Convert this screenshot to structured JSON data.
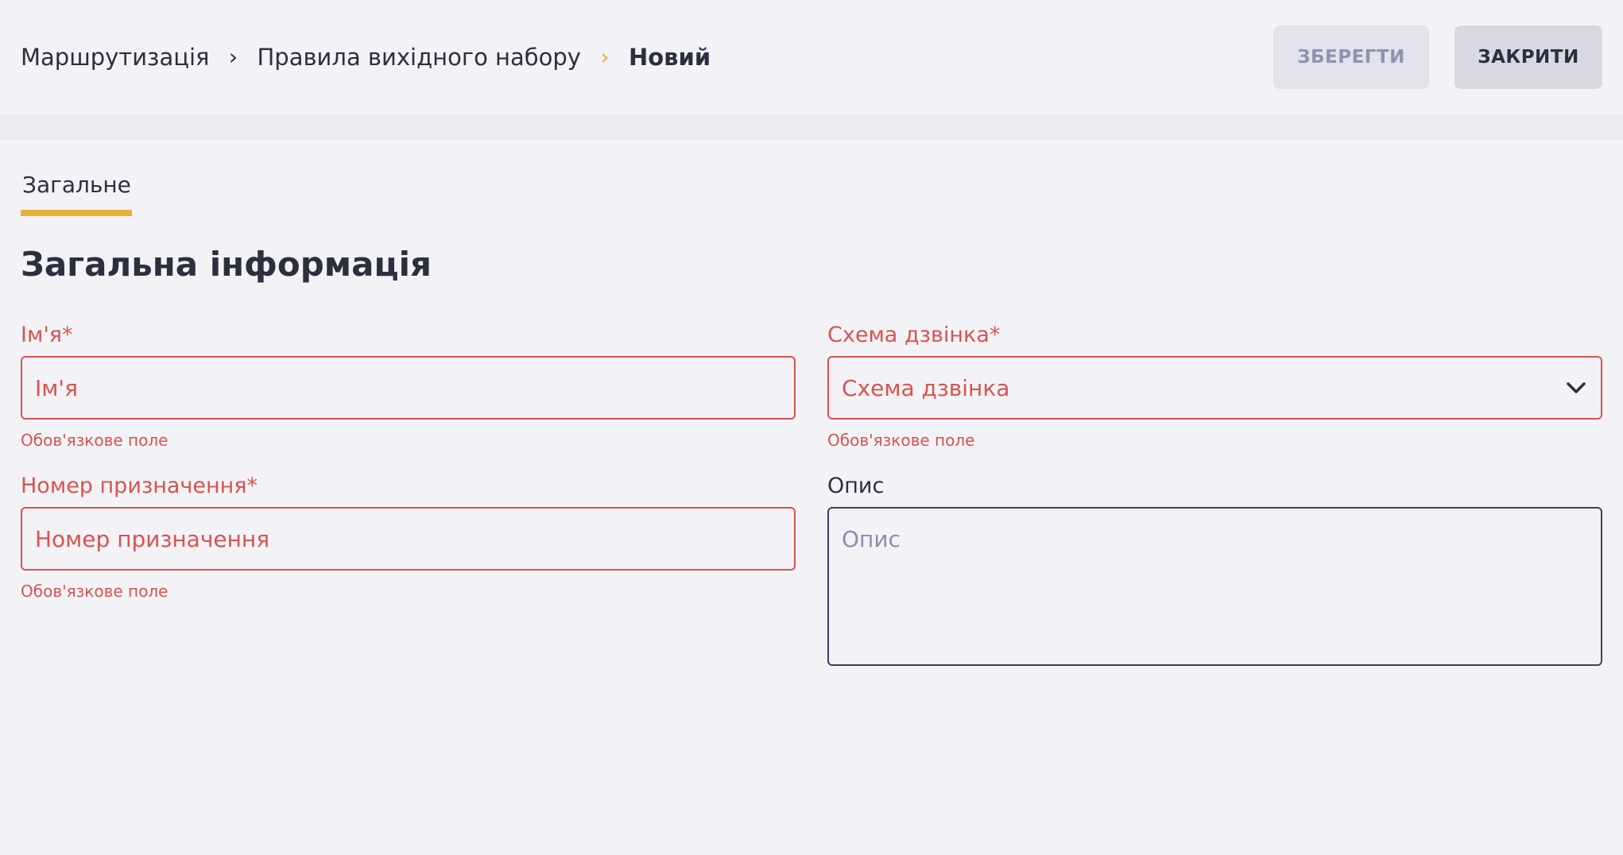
{
  "header": {
    "breadcrumb": {
      "items": [
        "Маршрутизація",
        "Правила вихідного набору"
      ],
      "current": "Новий",
      "separator": "›"
    },
    "save_label": "ЗБЕРЕГТИ",
    "close_label": "ЗАКРИТИ"
  },
  "tabs": [
    {
      "label": "Загальне",
      "active": true
    }
  ],
  "section_title": "Загальна інформація",
  "form": {
    "name": {
      "label": "Ім'я*",
      "value": "",
      "placeholder": "Ім'я",
      "error": "Обов'язкове поле"
    },
    "call_scheme": {
      "label": "Схема дзвінка*",
      "selected": "Схема дзвінка",
      "error": "Обов'язкове поле",
      "icon": "chevron-down-icon"
    },
    "destination_number": {
      "label": "Номер призначення*",
      "value": "",
      "placeholder": "Номер призначення",
      "error": "Обов'язкове поле"
    },
    "description": {
      "label": "Опис",
      "value": "",
      "placeholder": "Опис"
    }
  },
  "colors": {
    "accent": "#e8b13c",
    "error": "#d9534f",
    "text": "#2b2f3e",
    "background": "#f3f3f7"
  }
}
